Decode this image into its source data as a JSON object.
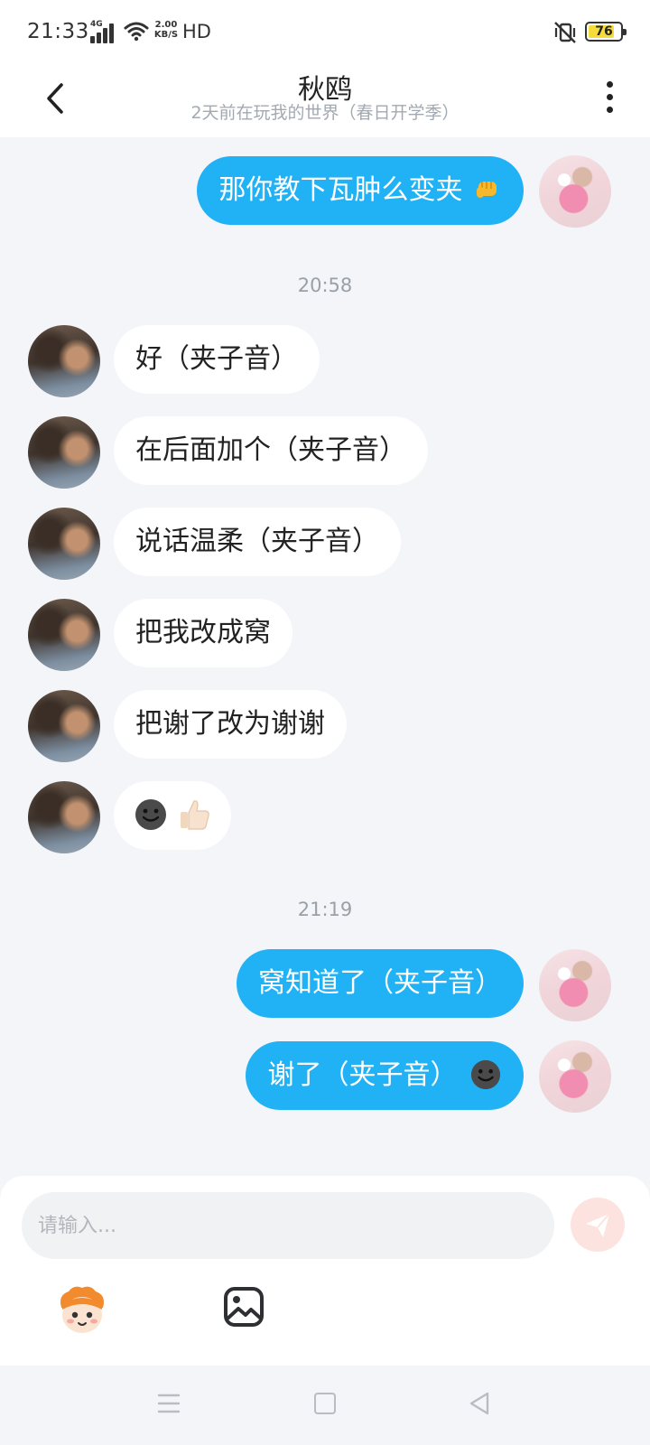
{
  "status_bar": {
    "time": "21:33",
    "network": "4G",
    "speed_value": "2.00",
    "speed_unit": "KB/S",
    "hd": "HD",
    "battery": "76"
  },
  "header": {
    "title": "秋鸥",
    "subtitle": "2天前在玩我的世界（春日开学季）"
  },
  "messages": [
    {
      "side": "out",
      "text": "那你教下瓦肿么变夹",
      "emoji": "fist-emoji"
    },
    {
      "type": "time",
      "text": "20:58"
    },
    {
      "side": "in",
      "text": "好（夹子音）"
    },
    {
      "side": "in",
      "text": "在后面加个（夹子音）"
    },
    {
      "side": "in",
      "text": "说话温柔（夹子音）"
    },
    {
      "side": "in",
      "text": "把我改成窝"
    },
    {
      "side": "in",
      "text": "把谢了改为谢谢"
    },
    {
      "side": "in",
      "text": "",
      "emoji": "dark-smiley-thumbsup-emoji"
    },
    {
      "type": "time",
      "text": "21:19"
    },
    {
      "side": "out",
      "text": "窝知道了（夹子音）"
    },
    {
      "side": "out",
      "text": "谢了（夹子音）",
      "emoji": "dark-smiley-emoji"
    }
  ],
  "composer": {
    "placeholder": "请输入..."
  },
  "colors": {
    "outgoing_bubble": "#21b2f6",
    "incoming_bubble": "#ffffff",
    "background": "#f3f5f8",
    "send_button": "#fde3df"
  }
}
